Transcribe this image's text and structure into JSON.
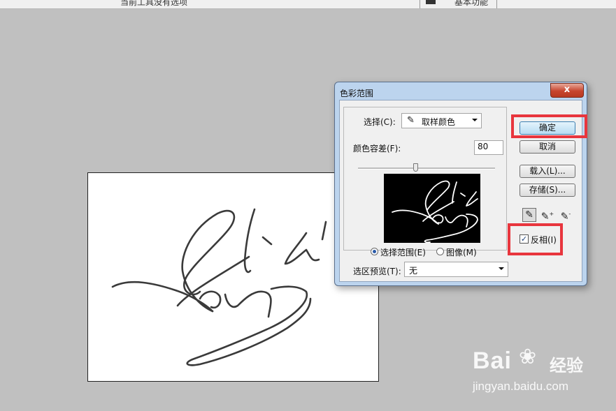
{
  "topbar": {
    "left_text": "当前工具没有选项",
    "right_text": "基本功能"
  },
  "dialog": {
    "title": "色彩范围",
    "close_label": "x",
    "select_label": "选择(C):",
    "select_value": "取样颜色",
    "fuzziness_label": "颜色容差(F):",
    "fuzziness_value": "80",
    "fuzziness_level": 0.42,
    "radio_selection_label": "选择范围(E)",
    "radio_image_label": "图像(M)",
    "radio_selected": "selection",
    "preview_label": "选区预览(T):",
    "preview_value": "无",
    "buttons": {
      "ok": "确定",
      "cancel": "取消",
      "load": "载入(L)...",
      "save": "存储(S)..."
    },
    "invert_label": "反相(I)",
    "invert_checked": true,
    "check_mark": "✓"
  },
  "watermark": {
    "brand": "Bai",
    "brand2": "经验",
    "url": "jingyan.baidu.com"
  },
  "colors": {
    "highlight": "#e8353d",
    "canvas_bg": "#c0c0c0",
    "dialog_frame": "#bcd4ee"
  }
}
